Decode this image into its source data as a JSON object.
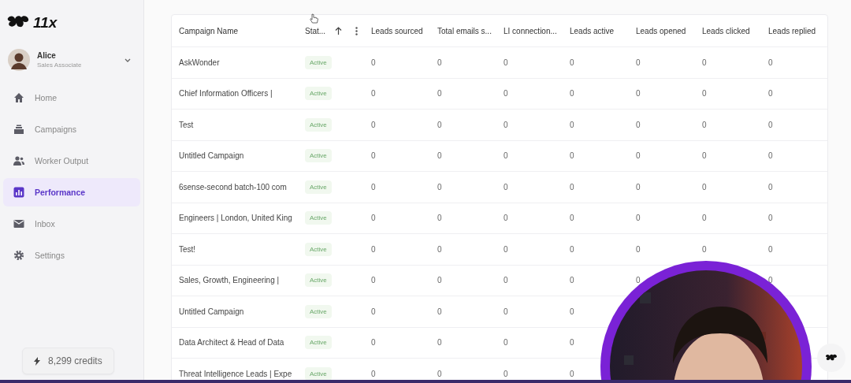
{
  "brand": {
    "name": "11x"
  },
  "user": {
    "name": "Alice",
    "role": "Sales Associate"
  },
  "nav": [
    {
      "label": "Home",
      "selected": false
    },
    {
      "label": "Campaigns",
      "selected": false
    },
    {
      "label": "Worker Output",
      "selected": false
    },
    {
      "label": "Performance",
      "selected": true
    },
    {
      "label": "Inbox",
      "selected": false
    },
    {
      "label": "Settings",
      "selected": false
    }
  ],
  "credits": "8,299 credits",
  "table": {
    "columns": [
      "Campaign Name",
      "Stat...",
      "Leads sourced",
      "Total emails s...",
      "LI connection...",
      "Leads active",
      "Leads opened",
      "Leads clicked",
      "Leads replied"
    ],
    "rows": [
      {
        "name": "AskWonder",
        "status": "Active",
        "values": {
          "leads_sourced": "0",
          "total_emails": "0",
          "li_connections": "0",
          "leads_active": "0",
          "leads_opened": "0",
          "leads_clicked": "0",
          "leads_replied": "0"
        }
      },
      {
        "name": "Chief Information Officers |",
        "status": "Active",
        "values": {
          "leads_sourced": "0",
          "total_emails": "0",
          "li_connections": "0",
          "leads_active": "0",
          "leads_opened": "0",
          "leads_clicked": "0",
          "leads_replied": "0"
        }
      },
      {
        "name": "Test",
        "status": "Active",
        "values": {
          "leads_sourced": "0",
          "total_emails": "0",
          "li_connections": "0",
          "leads_active": "0",
          "leads_opened": "0",
          "leads_clicked": "0",
          "leads_replied": "0"
        }
      },
      {
        "name": "Untitled Campaign",
        "status": "Active",
        "values": {
          "leads_sourced": "0",
          "total_emails": "0",
          "li_connections": "0",
          "leads_active": "0",
          "leads_opened": "0",
          "leads_clicked": "0",
          "leads_replied": "0"
        }
      },
      {
        "name": "6sense-second batch-100 com",
        "status": "Active",
        "values": {
          "leads_sourced": "0",
          "total_emails": "0",
          "li_connections": "0",
          "leads_active": "0",
          "leads_opened": "0",
          "leads_clicked": "0",
          "leads_replied": "0"
        }
      },
      {
        "name": "Engineers | London, United King",
        "status": "Active",
        "values": {
          "leads_sourced": "0",
          "total_emails": "0",
          "li_connections": "0",
          "leads_active": "0",
          "leads_opened": "0",
          "leads_clicked": "0",
          "leads_replied": "0"
        }
      },
      {
        "name": "Test!",
        "status": "Active",
        "values": {
          "leads_sourced": "0",
          "total_emails": "0",
          "li_connections": "0",
          "leads_active": "0",
          "leads_opened": "0",
          "leads_clicked": "0",
          "leads_replied": "0"
        }
      },
      {
        "name": "Sales, Growth, Engineering |",
        "status": "Active",
        "values": {
          "leads_sourced": "0",
          "total_emails": "0",
          "li_connections": "0",
          "leads_active": "0",
          "leads_opened": "0",
          "leads_replied": "0"
        }
      },
      {
        "name": "Untitled Campaign",
        "status": "Active",
        "values": {
          "leads_sourced": "0",
          "total_emails": "0",
          "li_connections": "0",
          "leads_active": "0"
        }
      },
      {
        "name": "Data Architect & Head of Data",
        "status": "Active",
        "values": {
          "leads_sourced": "0",
          "total_emails": "0",
          "li_connections": "0",
          "leads_active": "0"
        }
      },
      {
        "name": "Threat Intelligence Leads | Expe",
        "status": "Active",
        "values": {
          "leads_sourced": "0",
          "total_emails": "0",
          "li_connections": "0",
          "leads_active": "0"
        }
      }
    ]
  }
}
